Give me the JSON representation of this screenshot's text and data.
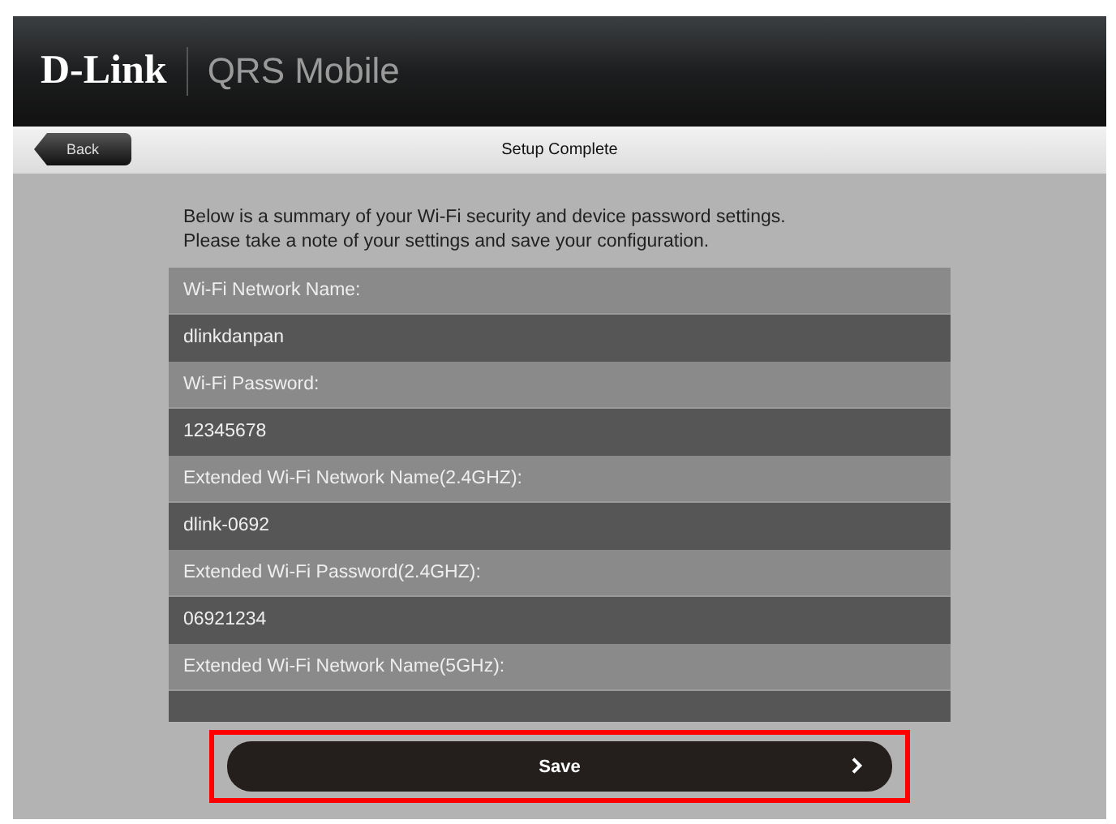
{
  "header": {
    "brand": "D-Link",
    "app_name": "QRS Mobile"
  },
  "nav": {
    "back": "Back",
    "title": "Setup Complete"
  },
  "intro": [
    "Below is a summary of your Wi-Fi security and device password settings.",
    "Please take a note of your settings and save your configuration."
  ],
  "settings": [
    {
      "kind": "label",
      "text": "Wi-Fi Network Name:"
    },
    {
      "kind": "value",
      "text": "dlinkdanpan"
    },
    {
      "kind": "label",
      "text": "Wi-Fi Password:"
    },
    {
      "kind": "value",
      "text": "12345678"
    },
    {
      "kind": "label",
      "text": "Extended Wi-Fi Network Name(2.4GHZ):"
    },
    {
      "kind": "value",
      "text": "dlink-0692"
    },
    {
      "kind": "label",
      "text": "Extended Wi-Fi Password(2.4GHZ):"
    },
    {
      "kind": "value",
      "text": "06921234"
    },
    {
      "kind": "label",
      "text": "Extended Wi-Fi Network Name(5GHz):"
    },
    {
      "kind": "value"
    }
  ],
  "save_button": {
    "label": "Save",
    "highlighted": true
  }
}
